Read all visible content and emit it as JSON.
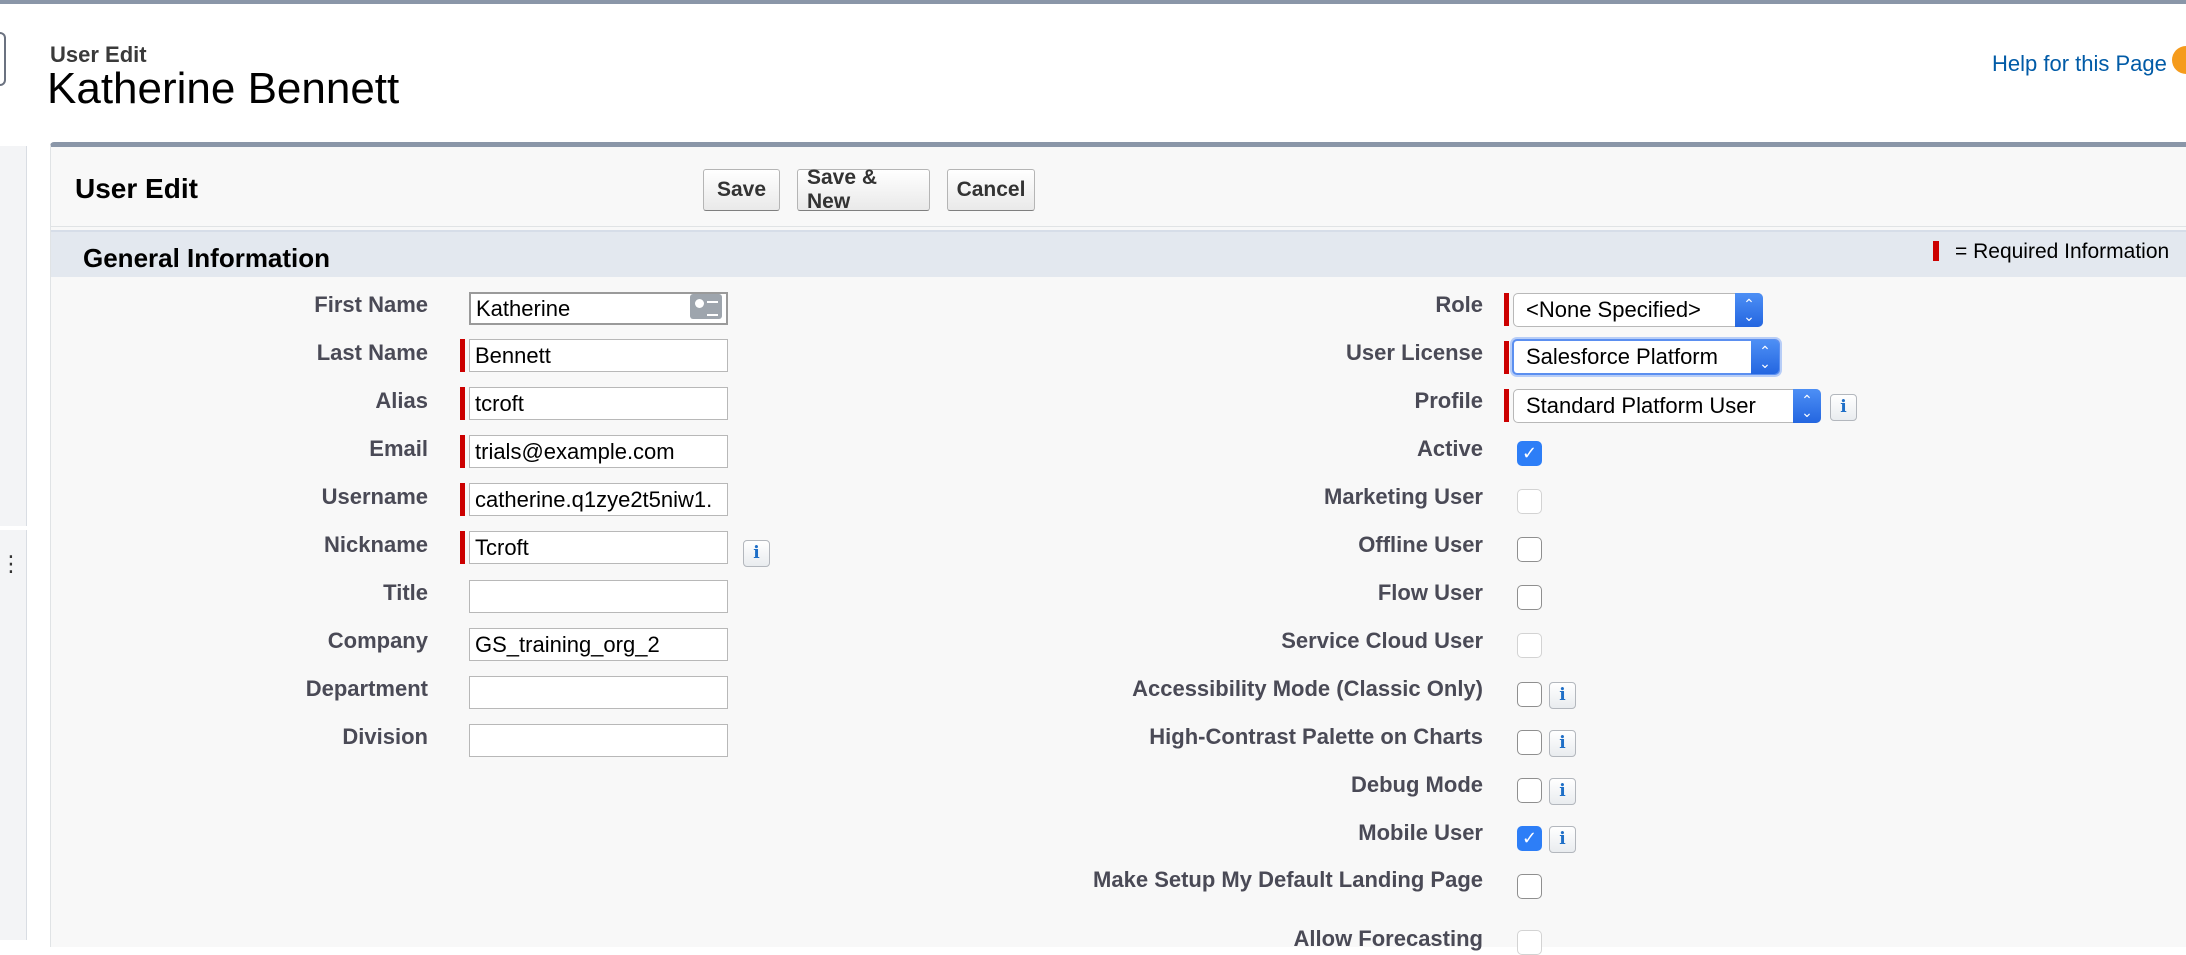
{
  "header": {
    "pre_title": "User Edit",
    "title": "Katherine Bennett",
    "help_link": "Help for this Page"
  },
  "panel": {
    "title": "User Edit",
    "buttons": {
      "save": "Save",
      "save_new": "Save & New",
      "cancel": "Cancel"
    }
  },
  "section": {
    "title": "General Information",
    "required_legend": "= Required Information"
  },
  "left_fields": [
    {
      "label": "First Name",
      "value": "Katherine",
      "required": false
    },
    {
      "label": "Last Name",
      "value": "Bennett",
      "required": true
    },
    {
      "label": "Alias",
      "value": "tcroft",
      "required": true
    },
    {
      "label": "Email",
      "value": "trials@example.com",
      "required": true
    },
    {
      "label": "Username",
      "value": "catherine.q1zye2t5niw1.",
      "required": true
    },
    {
      "label": "Nickname",
      "value": "Tcroft",
      "required": true
    },
    {
      "label": "Title",
      "value": "",
      "required": false
    },
    {
      "label": "Company",
      "value": "GS_training_org_2",
      "required": false
    },
    {
      "label": "Department",
      "value": "",
      "required": false
    },
    {
      "label": "Division",
      "value": "",
      "required": false
    }
  ],
  "right_selects": [
    {
      "label": "Role",
      "value": "<None Specified>"
    },
    {
      "label": "User License",
      "value": "Salesforce Platform"
    },
    {
      "label": "Profile",
      "value": "Standard Platform User"
    }
  ],
  "right_checkboxes": [
    {
      "label": "Active",
      "checked": true,
      "disabled": false
    },
    {
      "label": "Marketing User",
      "checked": false,
      "disabled": true
    },
    {
      "label": "Offline User",
      "checked": false,
      "disabled": false
    },
    {
      "label": "Flow User",
      "checked": false,
      "disabled": false
    },
    {
      "label": "Service Cloud User",
      "checked": false,
      "disabled": true
    },
    {
      "label": "Accessibility Mode (Classic Only)",
      "checked": false,
      "disabled": false
    },
    {
      "label": "High-Contrast Palette on Charts",
      "checked": false,
      "disabled": false
    },
    {
      "label": "Debug Mode",
      "checked": false,
      "disabled": false
    },
    {
      "label": "Mobile User",
      "checked": true,
      "disabled": false
    },
    {
      "label": "Make Setup My Default Landing Page",
      "checked": false,
      "disabled": false
    },
    {
      "label": "Allow Forecasting",
      "checked": false,
      "disabled": true
    }
  ],
  "icons": {
    "info": "info-icon",
    "card": "contact-card-icon",
    "checkmark": "✓",
    "help": "help-orange-icon"
  },
  "colors": {
    "required_marker": "#cc0000",
    "link": "#015ba7",
    "checkbox_checked": "#2d7ef7",
    "section_bar": "#e3e8ef"
  }
}
